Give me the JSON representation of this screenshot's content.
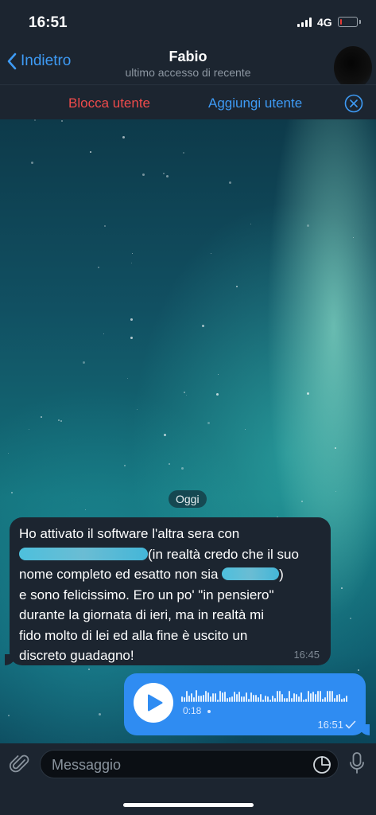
{
  "status_bar": {
    "time": "16:51",
    "network": "4G",
    "battery_level": 0.1
  },
  "header": {
    "back_label": "Indietro",
    "contact_name": "Fabio",
    "contact_status": "ultimo accesso di recente"
  },
  "action_bar": {
    "block_label": "Blocca utente",
    "add_label": "Aggiungi utente"
  },
  "chat": {
    "date_separator": "Oggi",
    "incoming": {
      "line1": "Ho attivato il software l'altra sera con",
      "line2_after_redaction": "(in realtà credo che il suo",
      "line3_before_redaction": "nome completo ed esatto non sia ",
      "line3_after_redaction": ")",
      "line4": "e sono felicissimo. Ero un po' \"in pensiero\"",
      "line5": "durante la giornata di ieri, ma in realtà mi",
      "line6": "fido molto di lei ed alla fine è uscito un",
      "line7": "discreto guadagno!",
      "time": "16:45"
    },
    "outgoing_voice": {
      "duration": "0:18",
      "time": "16:51"
    }
  },
  "composer": {
    "placeholder": "Messaggio"
  },
  "colors": {
    "accent": "#3e9bf5",
    "danger": "#ef4b4b",
    "bar_background": "#1c2530",
    "outgoing_bubble": "#2f8cf2"
  },
  "icons": [
    "chevron-left-icon",
    "close-circle-icon",
    "play-icon",
    "paperclip-icon",
    "sticker-icon",
    "microphone-icon",
    "checkmark-icon"
  ]
}
